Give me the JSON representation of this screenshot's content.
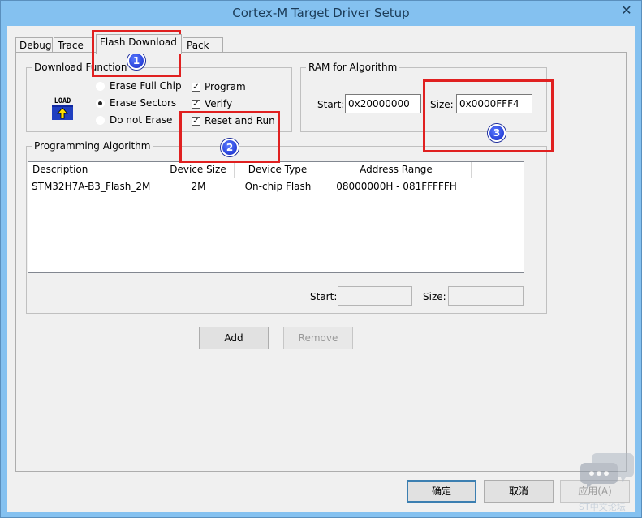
{
  "window": {
    "title": "Cortex-M Target Driver Setup",
    "close_glyph": "✕"
  },
  "tabs": [
    {
      "label": "Debug"
    },
    {
      "label": "Trace"
    },
    {
      "label": "Flash Download",
      "active": true
    },
    {
      "label": "Pack"
    }
  ],
  "download_function": {
    "label": "Download Function",
    "icon_text": "LOAD",
    "radios": [
      {
        "label": "Erase Full Chip",
        "selected": false
      },
      {
        "label": "Erase Sectors",
        "selected": true
      },
      {
        "label": "Do not Erase",
        "selected": false
      }
    ],
    "checks": [
      {
        "label": "Program",
        "checked": true
      },
      {
        "label": "Verify",
        "checked": true
      },
      {
        "label": "Reset and Run",
        "checked": true
      }
    ],
    "check_glyph": "✓"
  },
  "ram_for_algorithm": {
    "label": "RAM for Algorithm",
    "start_label": "Start:",
    "start_value": "0x20000000",
    "size_label": "Size:",
    "size_value": "0x0000FFF4"
  },
  "programming_algorithm": {
    "label": "Programming Algorithm",
    "columns": [
      "Description",
      "Device Size",
      "Device Type",
      "Address Range"
    ],
    "rows": [
      {
        "description": "STM32H7A-B3_Flash_2M",
        "size": "2M",
        "type": "On-chip Flash",
        "range": "08000000H - 081FFFFFH"
      }
    ],
    "start_label": "Start:",
    "start_value": "",
    "size_label": "Size:",
    "size_value": ""
  },
  "buttons": {
    "add": "Add",
    "remove": "Remove",
    "ok": "确定",
    "cancel": "取消",
    "apply": "应用(A)"
  },
  "annotations": [
    "1",
    "2",
    "3"
  ],
  "watermark": "ST中文论坛",
  "colors": {
    "highlight": "#e02020",
    "badge": "#1a2fd6"
  }
}
